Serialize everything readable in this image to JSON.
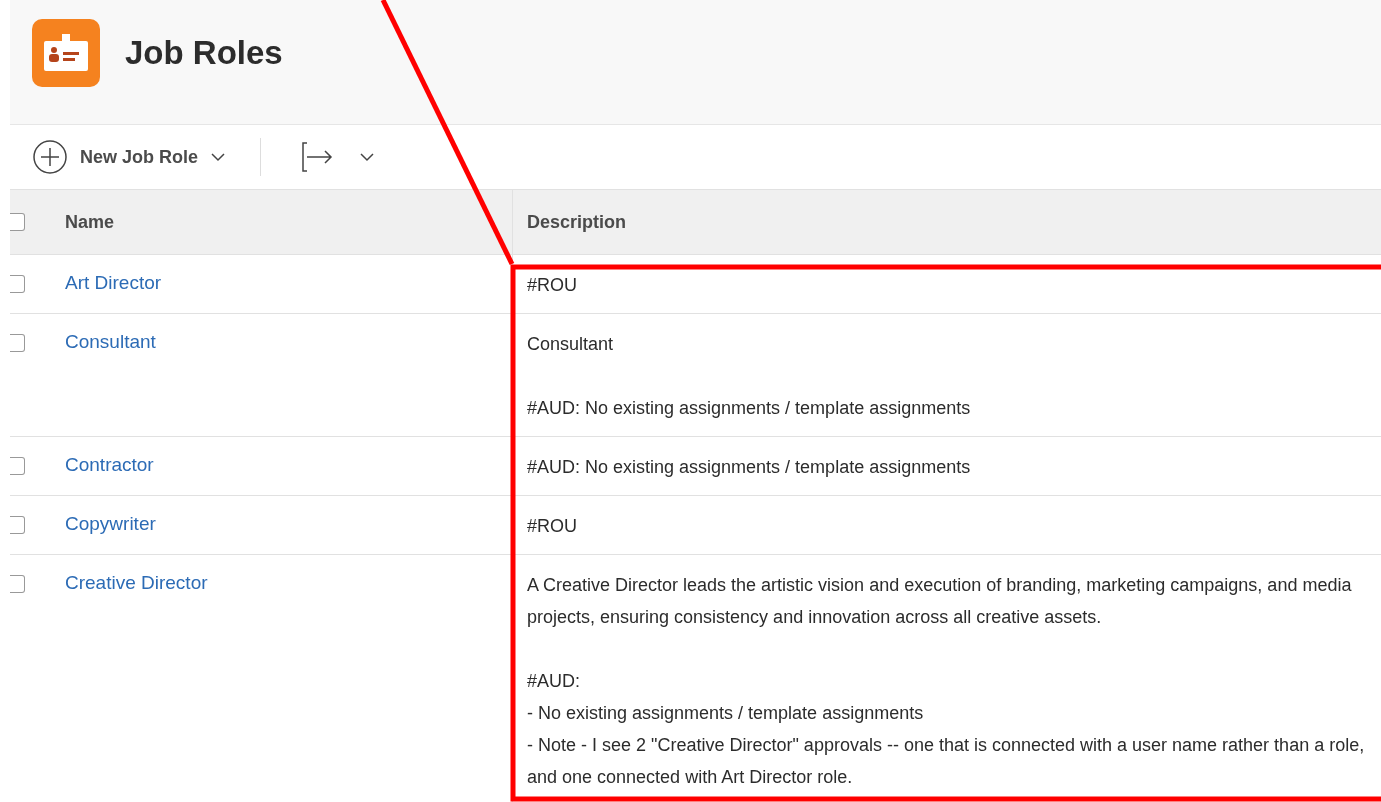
{
  "header": {
    "title": "Job Roles"
  },
  "toolbar": {
    "new_button": "New Job Role"
  },
  "table": {
    "columns": [
      "Name",
      "Description"
    ],
    "header_checked": false,
    "rows": [
      {
        "name": "Art Director",
        "checked": false,
        "description": [
          [
            "#ROU"
          ]
        ]
      },
      {
        "name": "Consultant",
        "checked": false,
        "description": [
          [
            "Consultant"
          ],
          [
            "#AUD: No existing assignments / template assignments"
          ]
        ]
      },
      {
        "name": "Contractor",
        "checked": false,
        "description": [
          [
            "#AUD: No existing assignments / template assignments"
          ]
        ]
      },
      {
        "name": "Copywriter",
        "checked": false,
        "description": [
          [
            "#ROU"
          ]
        ]
      },
      {
        "name": "Creative Director",
        "checked": false,
        "description": [
          [
            "A Creative Director leads the artistic vision and execution of branding, marketing campaigns, and media projects, ensuring consistency and innovation across all creative assets."
          ],
          [
            "#AUD:",
            "- No existing assignments / template assignments",
            "- Note - I see 2 \"Creative Director\" approvals -- one that is connected with a user name rather than a role, and one connected with Art Director role."
          ]
        ]
      }
    ]
  },
  "annotation": {
    "kind": "highlight"
  }
}
